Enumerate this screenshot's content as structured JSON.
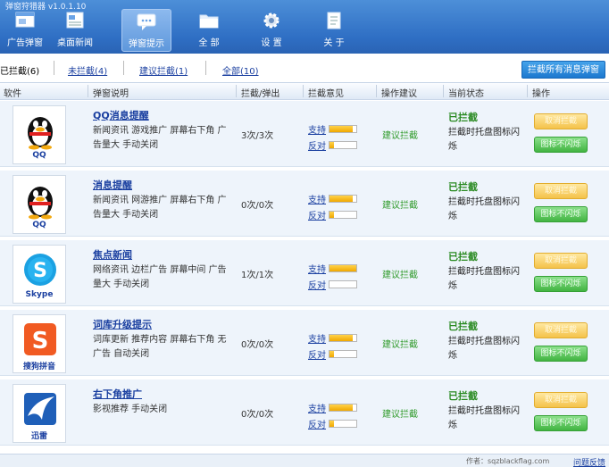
{
  "app": {
    "title": "弹窗狩猎器 v1.0.1.10"
  },
  "toolbar": {
    "items": [
      {
        "label": "广告弹窗"
      },
      {
        "label": "桌面新闻"
      },
      {
        "label": "弹窗提示"
      },
      {
        "label": "全 部"
      },
      {
        "label": "设 置"
      },
      {
        "label": "关 于"
      }
    ],
    "active_index": 2
  },
  "filters": {
    "blocked": "已拦截(6)",
    "unblocked": "未拦截(4)",
    "suggested": "建议拦截(1)",
    "all": "全部(10)",
    "block_all_button": "拦截所有消息弹窗"
  },
  "table": {
    "headers": [
      "软件",
      "弹窗说明",
      "拦截/弹出",
      "拦截意见",
      "操作建议",
      "当前状态",
      "操作"
    ],
    "rows": [
      {
        "app_name": "QQ",
        "icon": "qq-penguin-icon",
        "title": "QQ消息提醒",
        "desc": "新闻资讯 游戏推广 屏幕右下角 广告量大 手动关闭",
        "count": "3次/3次",
        "support": "支持",
        "oppose": "反对",
        "support_level": 0.85,
        "oppose_level": 0.15,
        "advice": "建议拦截",
        "status": "已拦截",
        "status_desc": "拦截时托盘图标闪烁",
        "cancel": "取消拦截",
        "noflash": "图标不闪烁"
      },
      {
        "app_name": "QQ",
        "icon": "qq-penguin-icon",
        "title": "消息提醒",
        "desc": "新闻资讯 网游推广 屏幕右下角 广告量大 手动关闭",
        "count": "0次/0次",
        "support": "支持",
        "oppose": "反对",
        "support_level": 0.85,
        "oppose_level": 0.15,
        "advice": "建议拦截",
        "status": "已拦截",
        "status_desc": "拦截时托盘图标闪烁",
        "cancel": "取消拦截",
        "noflash": "图标不闪烁"
      },
      {
        "app_name": "Skype",
        "icon": "skype-icon",
        "title": "焦点新闻",
        "desc": "网络资讯 边栏广告 屏幕中间 广告量大 手动关闭",
        "count": "1次/1次",
        "support": "支持",
        "oppose": "反对",
        "support_level": 1.0,
        "oppose_level": 0.0,
        "advice": "建议拦截",
        "status": "已拦截",
        "status_desc": "拦截时托盘图标闪烁",
        "cancel": "取消拦截",
        "noflash": "图标不闪烁"
      },
      {
        "app_name": "搜狗拼音",
        "icon": "sogou-pinyin-icon",
        "title": "词库升级提示",
        "desc": "词库更新 推荐内容 屏幕右下角 无广告 自动关闭",
        "count": "0次/0次",
        "support": "支持",
        "oppose": "反对",
        "support_level": 0.85,
        "oppose_level": 0.15,
        "advice": "建议拦截",
        "status": "已拦截",
        "status_desc": "拦截时托盘图标闪烁",
        "cancel": "取消拦截",
        "noflash": "图标不闪烁"
      },
      {
        "app_name": "迅雷",
        "icon": "xunlei-icon",
        "title": "右下角推广",
        "desc": "影视推荐 手动关闭",
        "count": "0次/0次",
        "support": "支持",
        "oppose": "反对",
        "support_level": 0.85,
        "oppose_level": 0.15,
        "advice": "建议拦截",
        "status": "已拦截",
        "status_desc": "拦截时托盘图标闪烁",
        "cancel": "取消拦截",
        "noflash": "图标不闪烁"
      }
    ]
  },
  "footer": {
    "author": "作者：sqzblackflag.com",
    "feedback": "问题反馈"
  },
  "colors": {
    "toolbar": "#2f6fc4",
    "link": "#1a3fa0",
    "status_green": "#2a8a22",
    "bar_fill": "#f0a800"
  }
}
